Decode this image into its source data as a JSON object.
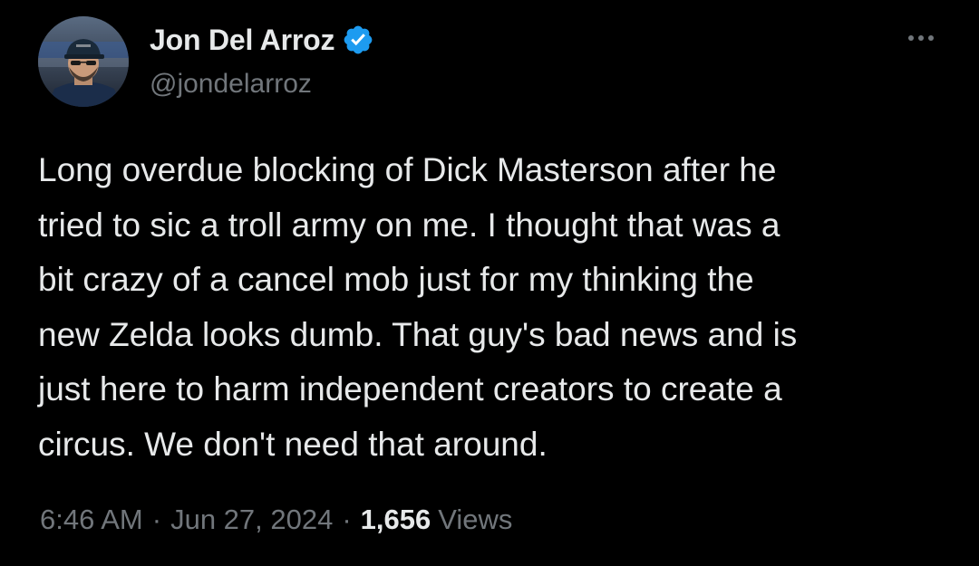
{
  "author": {
    "display_name": "Jon Del Arroz",
    "handle": "@jondelarroz",
    "verified": true,
    "verified_color": "#1d9bf0",
    "avatar_icon": "user-avatar-photo"
  },
  "actions": {
    "more_icon": "more-horizontal-icon"
  },
  "tweet": {
    "text_lines": [
      "Long overdue blocking of Dick Masterson after he",
      "tried to sic a troll army on me. I thought that was a",
      "bit crazy of a cancel mob just for my thinking the",
      "new Zelda looks dumb. That guy's bad news and is",
      "just here to harm independent creators to create a",
      "circus. We don't need that around."
    ]
  },
  "meta": {
    "time": "6:46 AM",
    "separator": "·",
    "date": "Jun 27, 2024",
    "views_count": "1,656",
    "views_label": "Views"
  },
  "colors": {
    "background": "#000000",
    "primary_text": "#e7e9ea",
    "secondary_text": "#71767b"
  }
}
